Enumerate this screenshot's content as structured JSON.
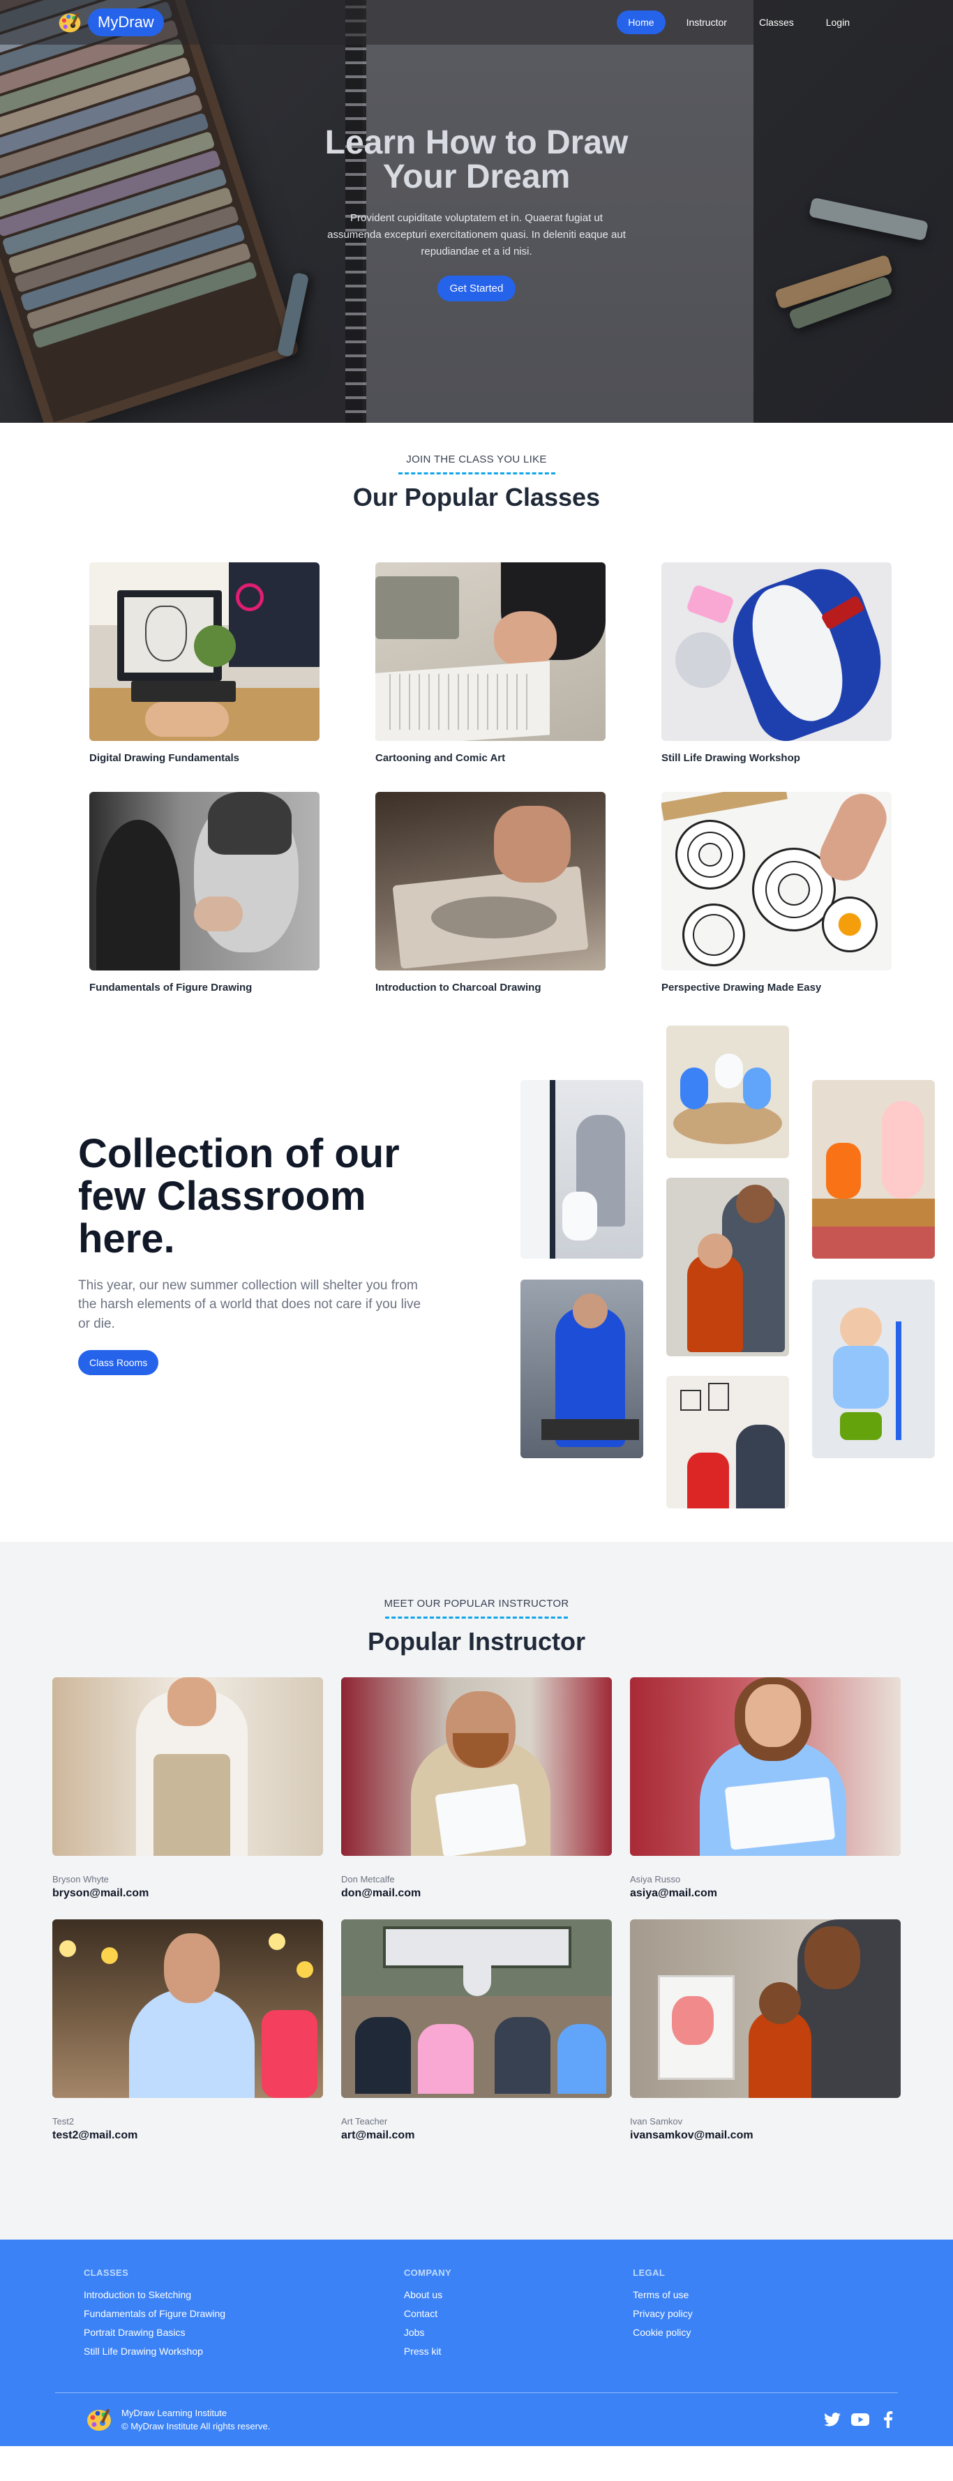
{
  "nav": {
    "brand": "MyDraw",
    "links": [
      "Home",
      "Instructor",
      "Classes",
      "Login"
    ],
    "active": "Home"
  },
  "hero": {
    "title": "Learn How to Draw Your Dream",
    "text": "Provident cupiditate voluptatem et in. Quaerat fugiat ut assumenda excepturi exercitationem quasi. In deleniti eaque aut repudiandae et a id nisi.",
    "cta": "Get Started"
  },
  "classes": {
    "kicker": "JOIN THE CLASS YOU LIKE",
    "title": "Our Popular Classes",
    "items": [
      "Digital Drawing Fundamentals",
      "Cartooning and Comic Art",
      "Still Life Drawing Workshop",
      "Fundamentals of Figure Drawing",
      "Introduction to Charcoal Drawing",
      "Perspective Drawing Made Easy"
    ]
  },
  "collection": {
    "title": "Collection of our few Classroom here.",
    "text": "This year, our new summer collection will shelter you from the harsh elements of a world that does not care if you live or die.",
    "cta": "Class Rooms"
  },
  "instructors": {
    "kicker": "MEET OUR POPULAR INSTRUCTOR",
    "title": "Popular Instructor",
    "items": [
      {
        "role": "Bryson Whyte",
        "email": "bryson@mail.com"
      },
      {
        "role": "Don Metcalfe",
        "email": "don@mail.com"
      },
      {
        "role": "Asiya Russo",
        "email": "asiya@mail.com"
      },
      {
        "role": "Test2",
        "email": "test2@mail.com"
      },
      {
        "role": "Art Teacher",
        "email": "art@mail.com"
      },
      {
        "role": "Ivan Samkov",
        "email": "ivansamkov@mail.com"
      }
    ]
  },
  "footer": {
    "columns": [
      {
        "heading": "CLASSES",
        "links": [
          "Introduction to Sketching",
          "Fundamentals of Figure Drawing",
          "Portrait Drawing Basics",
          "Still Life Drawing Workshop"
        ]
      },
      {
        "heading": "COMPANY",
        "links": [
          "About us",
          "Contact",
          "Jobs",
          "Press kit"
        ]
      },
      {
        "heading": "LEGAL",
        "links": [
          "Terms of use",
          "Privacy policy",
          "Cookie policy"
        ]
      }
    ],
    "org": "MyDraw Learning Institute",
    "copyright": "© MyDraw Institute All rights reserve.",
    "socials": [
      "twitter-icon",
      "youtube-icon",
      "facebook-icon"
    ]
  },
  "colors": {
    "primary": "#2563eb",
    "footer": "#3b82f6",
    "accent_line": "#0ea5e9"
  }
}
